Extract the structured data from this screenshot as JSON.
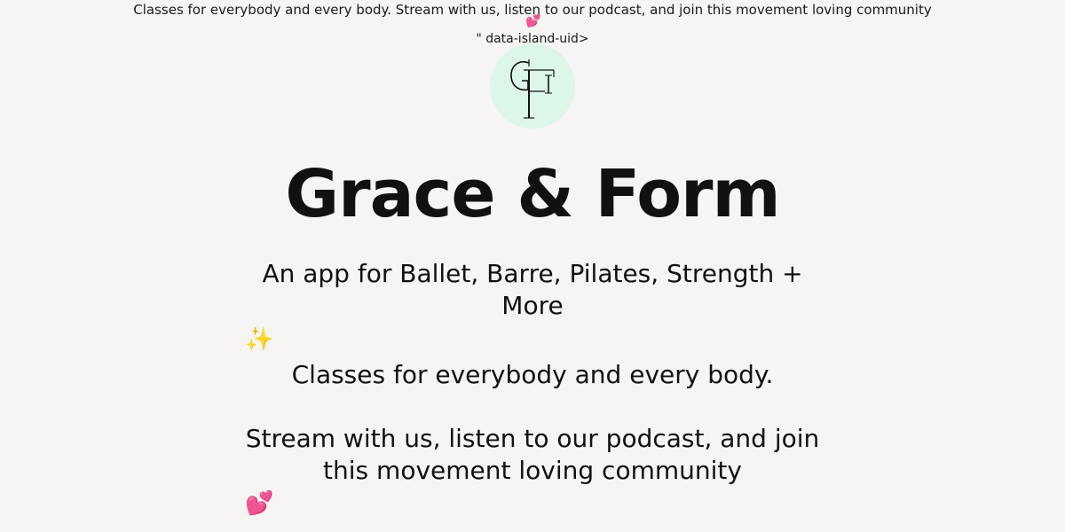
{
  "page": {
    "top_description": "Classes for everybody and every body. Stream with us, listen to our podcast, and join this movement loving community",
    "attr_leak": "\" data-island-uid>",
    "logo_text": "GF",
    "title": "Grace & Form",
    "subtitle": "An app for Ballet, Barre, Pilates, Strength + More",
    "paragraph_1": "Classes for everybody and every body.",
    "paragraph_2": "Stream with us, listen to our podcast, and join this movement loving community",
    "sparkles_emoji": "✨",
    "hearts_emoji": "💕"
  },
  "colors": {
    "background": "#f6f5f3",
    "logo_circle": "#dcf6e8",
    "text": "#111111"
  },
  "icons": {
    "sparkles": "sparkles-icon",
    "hearts": "two-hearts-icon"
  }
}
